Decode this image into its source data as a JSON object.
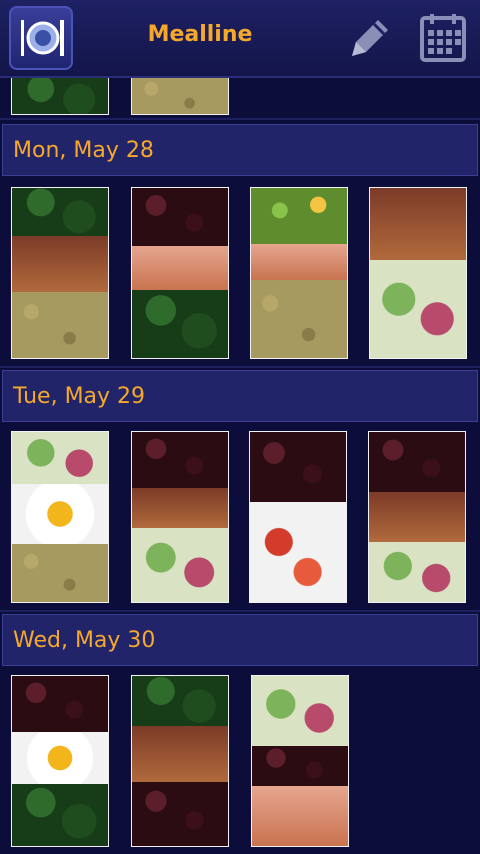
{
  "app": {
    "title": "Mealline",
    "icons": {
      "app": "plate-fork-knife-icon",
      "edit": "pencil-icon",
      "calendar": "calendar-icon"
    },
    "accent_color": "#f6a82b",
    "background_color": "#0c0d3a"
  },
  "sections": [
    {
      "label": "Mon, May 28",
      "photos": 4
    },
    {
      "label": "Tue, May 29",
      "photos": 4
    },
    {
      "label": "Wed, May 30",
      "photos": 3
    }
  ]
}
